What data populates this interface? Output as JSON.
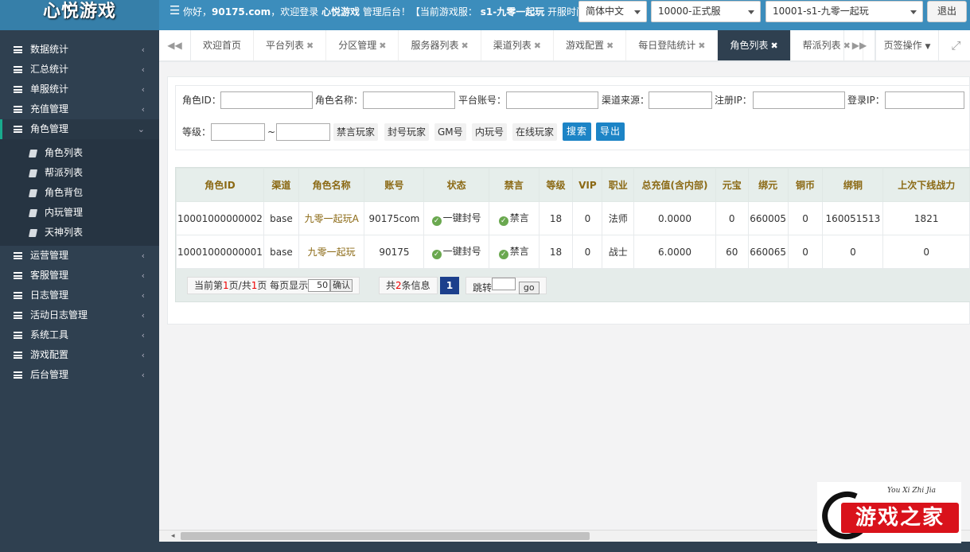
{
  "header": {
    "logo": "心悦游戏",
    "welcome_pre": "你好，",
    "username": "90175.com",
    "welcome_mid": "，欢迎登录",
    "system_name": "心悦游戏",
    "welcome_post": "管理后台！【当前游戏服：",
    "current_server": "s1-九零一起玩",
    "welcome_tail": "开服时间",
    "language": "简体中文",
    "server_group": "10000-正式服",
    "server": "10001-s1-九零一起玩",
    "logout": "退出"
  },
  "sidebar": {
    "items_top": [
      {
        "label": "数据统计"
      },
      {
        "label": "汇总统计"
      },
      {
        "label": "单服统计"
      },
      {
        "label": "充值管理"
      }
    ],
    "active": {
      "label": "角色管理"
    },
    "sub_items": [
      {
        "label": "角色列表"
      },
      {
        "label": "帮派列表"
      },
      {
        "label": "角色背包"
      },
      {
        "label": "内玩管理"
      },
      {
        "label": "天神列表"
      }
    ],
    "items_bottom": [
      {
        "label": "运营管理"
      },
      {
        "label": "客服管理"
      },
      {
        "label": "日志管理"
      },
      {
        "label": "活动日志管理"
      },
      {
        "label": "系统工具"
      },
      {
        "label": "游戏配置"
      },
      {
        "label": "后台管理"
      }
    ]
  },
  "tabs": {
    "items": [
      {
        "label": "欢迎首页"
      },
      {
        "label": "平台列表"
      },
      {
        "label": "分区管理"
      },
      {
        "label": "服务器列表"
      },
      {
        "label": "渠道列表"
      },
      {
        "label": "游戏配置"
      },
      {
        "label": "每日登陆统计"
      },
      {
        "label": "角色列表"
      },
      {
        "label": "帮派列表"
      }
    ],
    "active_index": 7,
    "operations": "页签操作"
  },
  "search": {
    "role_id": "角色ID：",
    "role_name": "角色名称：",
    "platform_account": "平台账号：",
    "channel": "渠道来源：",
    "register_ip": "注册IP：",
    "login_ip": "登录IP：",
    "level": "等级：",
    "tilde": "~",
    "muted": "禁言玩家",
    "banned": "封号玩家",
    "gm": "GM号",
    "internal": "内玩号",
    "online": "在线玩家",
    "search_btn": "搜索",
    "export_btn": "导出"
  },
  "table": {
    "headers": [
      "角色ID",
      "渠道",
      "角色名称",
      "账号",
      "状态",
      "禁言",
      "等级",
      "VIP",
      "职业",
      "总充值(含内部)",
      "元宝",
      "绑元",
      "铜币",
      "绑铜",
      "上次下线战力"
    ],
    "rows": [
      [
        "10001000000002",
        "base",
        "九零一起玩A",
        "90175com",
        "一键封号",
        "禁言",
        "18",
        "0",
        "法师",
        "0.0000",
        "0",
        "660005",
        "0",
        "160051513",
        "1821"
      ],
      [
        "10001000000001",
        "base",
        "九零一起玩",
        "90175",
        "一键封号",
        "禁言",
        "18",
        "0",
        "战士",
        "6.0000",
        "60",
        "660065",
        "0",
        "0",
        "0"
      ]
    ]
  },
  "pager": {
    "p1": "当前第",
    "current": "1",
    "p2": "页/共",
    "total_pages": "1",
    "p3": "页 每页显示",
    "per_page": "50",
    "confirm": "确认",
    "t1": "共",
    "total": "2",
    "t2": "条信息",
    "page_btn": "1",
    "jump": "跳转",
    "go": "go"
  },
  "brand": {
    "text": "游戏之家",
    "script": "You Xi Zhi Jia"
  }
}
